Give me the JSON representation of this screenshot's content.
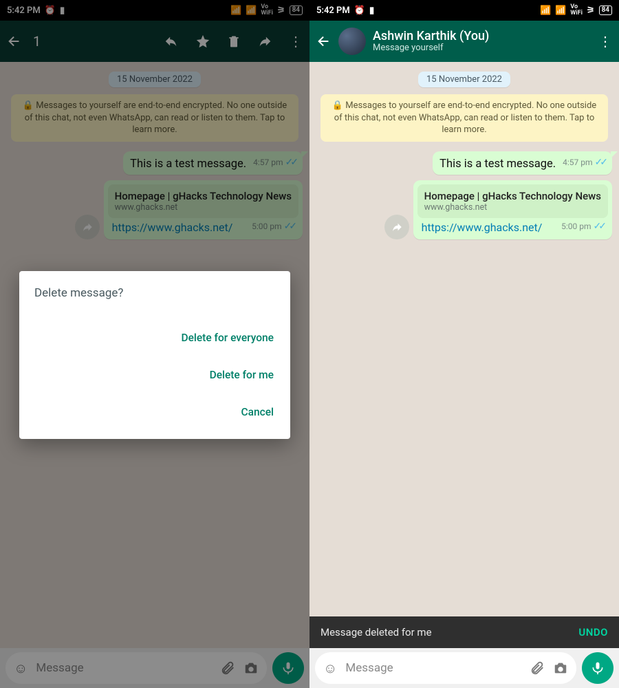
{
  "status": {
    "time": "5:42 PM",
    "battery": "84"
  },
  "left": {
    "selection_count": "1",
    "date_chip": "15 November 2022",
    "encryption_notice": "🔒 Messages to yourself are end-to-end encrypted. No one outside of this chat, not even WhatsApp, can read or listen to them. Tap to learn more.",
    "msg1": {
      "text": "This is a test message.",
      "time": "4:57 pm"
    },
    "msg2": {
      "preview_title": "Homepage | gHacks Technology News",
      "preview_domain": "www.ghacks.net",
      "url": "https://www.ghacks.net/",
      "time": "5:00 pm"
    },
    "dialog": {
      "title": "Delete message?",
      "delete_everyone": "Delete for everyone",
      "delete_me": "Delete for me",
      "cancel": "Cancel"
    },
    "input_placeholder": "Message"
  },
  "right": {
    "contact_name": "Ashwin Karthik (You)",
    "contact_sub": "Message yourself",
    "date_chip": "15 November 2022",
    "encryption_notice": "🔒 Messages to yourself are end-to-end encrypted. No one outside of this chat, not even WhatsApp, can read or listen to them. Tap to learn more.",
    "msg1": {
      "text": "This is a test message.",
      "time": "4:57 pm"
    },
    "msg2": {
      "preview_title": "Homepage | gHacks Technology News",
      "preview_domain": "www.ghacks.net",
      "url": "https://www.ghacks.net/",
      "time": "5:00 pm"
    },
    "snackbar": {
      "text": "Message deleted for me",
      "undo": "UNDO"
    },
    "input_placeholder": "Message"
  }
}
